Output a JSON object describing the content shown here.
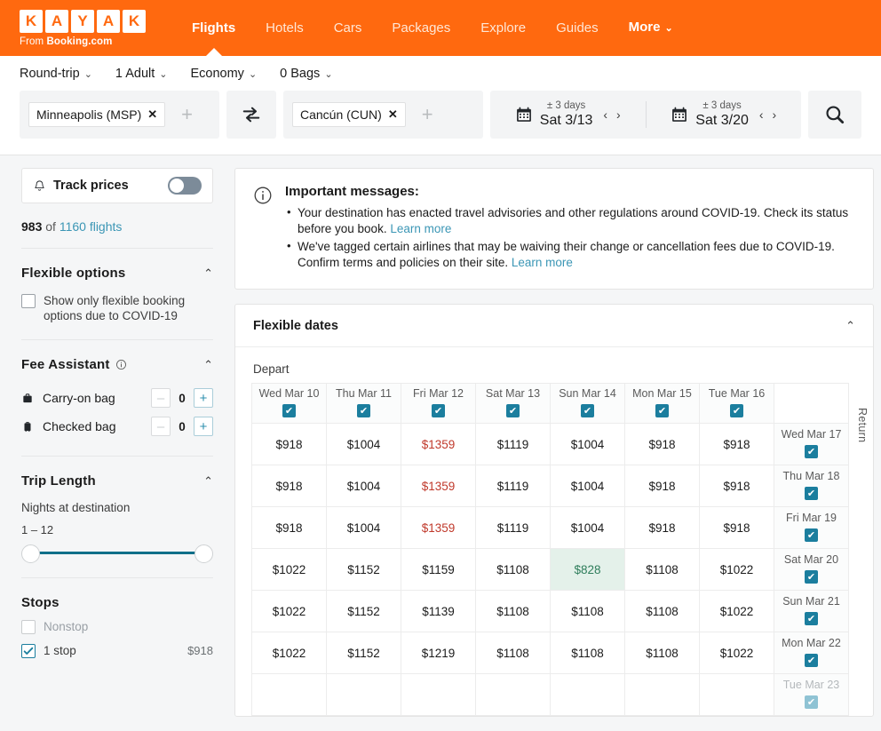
{
  "nav": {
    "logo_letters": [
      "K",
      "A",
      "Y",
      "A",
      "K"
    ],
    "logo_sub_pre": "From ",
    "logo_sub_brand": "Booking.com",
    "links": [
      {
        "label": "Flights",
        "active": true
      },
      {
        "label": "Hotels",
        "active": false
      },
      {
        "label": "Cars",
        "active": false
      },
      {
        "label": "Packages",
        "active": false
      },
      {
        "label": "Explore",
        "active": false
      },
      {
        "label": "Guides",
        "active": false
      },
      {
        "label": "More",
        "active": false,
        "caret": "⌄"
      }
    ]
  },
  "search": {
    "options": [
      {
        "label": "Round-trip",
        "caret": "⌄"
      },
      {
        "label": "1 Adult",
        "caret": "⌄"
      },
      {
        "label": "Economy",
        "caret": "⌄"
      },
      {
        "label": "0 Bags",
        "caret": "⌄"
      }
    ],
    "origin_chip": "Minneapolis (MSP)",
    "destination_chip": "Cancún (CUN)",
    "chip_close": "✕",
    "add_symbol": "+",
    "depart": {
      "flex": "± 3 days",
      "value": "Sat 3/13",
      "prev": "‹",
      "next": "›"
    },
    "return": {
      "flex": "± 3 days",
      "value": "Sat 3/20",
      "prev": "‹",
      "next": "›"
    }
  },
  "sidebar": {
    "track_prices_label": "Track prices",
    "count_bold": "983",
    "count_mid": " of ",
    "count_link": "1160 flights",
    "flexible": {
      "title": "Flexible options",
      "checkbox_label": "Show only flexible booking options due to COVID-19"
    },
    "fee_assistant": {
      "title": "Fee Assistant",
      "rows": [
        {
          "label": "Carry-on bag",
          "value": "0"
        },
        {
          "label": "Checked bag",
          "value": "0"
        }
      ],
      "minus": "–",
      "plus": "+"
    },
    "trip_length": {
      "title": "Trip Length",
      "sublabel": "Nights at destination",
      "range": "1 – 12"
    },
    "stops": {
      "title": "Stops",
      "items": [
        {
          "label": "Nonstop",
          "price": "",
          "checked": false,
          "disabled": true
        },
        {
          "label": "1 stop",
          "price": "$918",
          "checked": true,
          "disabled": false
        }
      ]
    }
  },
  "messages": {
    "title": "Important messages:",
    "items": [
      {
        "text": "Your destination has enacted travel advisories and other regulations around COVID-19. Check its status before you book. ",
        "link": "Learn more"
      },
      {
        "text": "We've tagged certain airlines that may be waiving their change or cancellation fees due to COVID-19. Confirm terms and policies on their site. ",
        "link": "Learn more"
      }
    ]
  },
  "flexible_dates": {
    "title": "Flexible dates",
    "depart_label": "Depart",
    "return_label": "Return",
    "tick_glyph": "✔",
    "chart_data": {
      "type": "table",
      "title": "Flexible dates price matrix",
      "xlabel": "Depart",
      "ylabel": "Return",
      "depart_dates": [
        "Wed Mar 10",
        "Thu Mar 11",
        "Fri Mar 12",
        "Sat Mar 13",
        "Sun Mar 14",
        "Mon Mar 15",
        "Tue Mar 16"
      ],
      "return_dates": [
        "Wed Mar 17",
        "Thu Mar 18",
        "Fri Mar 19",
        "Sat Mar 20",
        "Sun Mar 21",
        "Mon Mar 22",
        "Tue Mar 23"
      ],
      "rows": [
        {
          "return": "Wed Mar 17",
          "checked": true,
          "dim": false,
          "prices": [
            "$918",
            "$1004",
            "$1359",
            "$1119",
            "$1004",
            "$918",
            "$918"
          ],
          "styles": [
            "",
            "",
            "high",
            "",
            "",
            "",
            ""
          ]
        },
        {
          "return": "Thu Mar 18",
          "checked": true,
          "dim": false,
          "prices": [
            "$918",
            "$1004",
            "$1359",
            "$1119",
            "$1004",
            "$918",
            "$918"
          ],
          "styles": [
            "",
            "",
            "high",
            "",
            "",
            "",
            ""
          ]
        },
        {
          "return": "Fri Mar 19",
          "checked": true,
          "dim": false,
          "prices": [
            "$918",
            "$1004",
            "$1359",
            "$1119",
            "$1004",
            "$918",
            "$918"
          ],
          "styles": [
            "",
            "",
            "high",
            "",
            "",
            "",
            ""
          ]
        },
        {
          "return": "Sat Mar 20",
          "checked": true,
          "dim": false,
          "prices": [
            "$1022",
            "$1152",
            "$1159",
            "$1108",
            "$828",
            "$1108",
            "$1022"
          ],
          "styles": [
            "",
            "",
            "",
            "",
            "low",
            "",
            ""
          ]
        },
        {
          "return": "Sun Mar 21",
          "checked": true,
          "dim": false,
          "prices": [
            "$1022",
            "$1152",
            "$1139",
            "$1108",
            "$1108",
            "$1108",
            "$1022"
          ],
          "styles": [
            "",
            "",
            "",
            "",
            "",
            "",
            ""
          ]
        },
        {
          "return": "Mon Mar 22",
          "checked": true,
          "dim": false,
          "prices": [
            "$1022",
            "$1152",
            "$1219",
            "$1108",
            "$1108",
            "$1108",
            "$1022"
          ],
          "styles": [
            "",
            "",
            "",
            "",
            "",
            "",
            ""
          ]
        },
        {
          "return": "Tue Mar 23",
          "checked": true,
          "dim": true,
          "prices": [
            "",
            "",
            "",
            "",
            "",
            "",
            ""
          ],
          "styles": [
            "blank",
            "blank",
            "blank",
            "blank",
            "blank",
            "blank",
            "blank"
          ]
        }
      ],
      "lowest_price": "$828",
      "highest_price": "$1359"
    }
  },
  "colors": {
    "brand_orange": "#ff690f",
    "link_blue": "#3b96b5",
    "teal": "#1b7e9e",
    "high_price_red": "#c0392b",
    "low_price_green": "#2e7d5b"
  }
}
